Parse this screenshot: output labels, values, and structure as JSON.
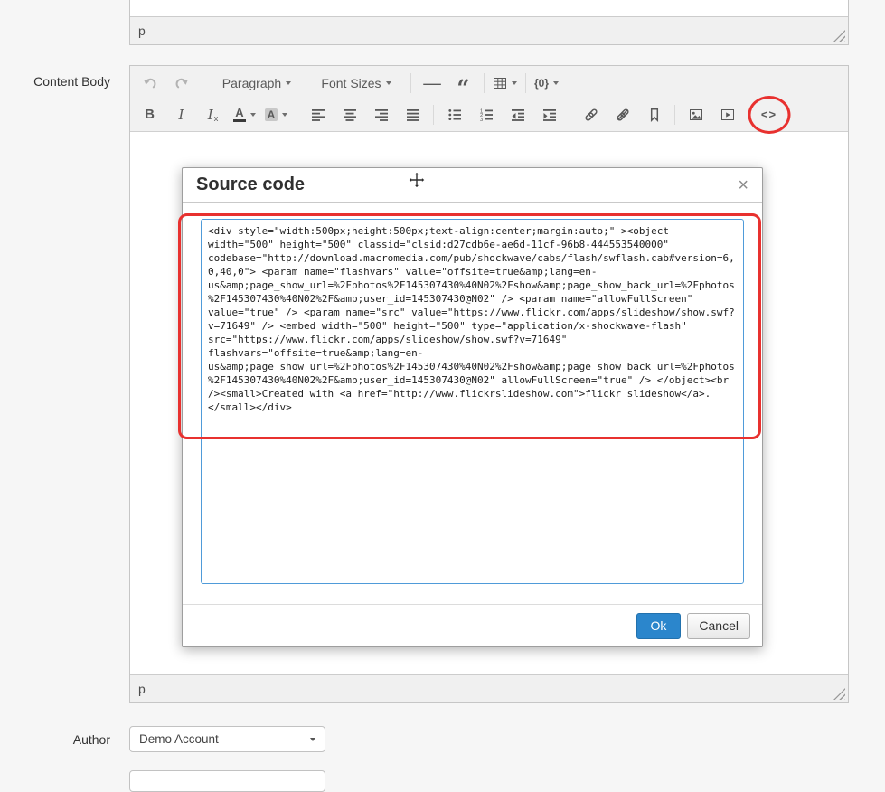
{
  "colors": {
    "primary_button": "#2b86cc",
    "annotation_red": "#e8312f",
    "focused_textarea_border": "#4f9bd9",
    "toolbar_background": "#f1f1f1"
  },
  "previous_editor": {
    "status_path": "p"
  },
  "editor": {
    "label": "Content Body",
    "status_path": "p",
    "toolbar": {
      "paragraph_label": "Paragraph",
      "font_sizes_label": "Font Sizes",
      "hr_glyph": "—",
      "blockquote_glyph": "“",
      "token_glyph": "{0}",
      "bold_glyph": "B",
      "italic_glyph": "I",
      "clearformat_glyph": "I",
      "clearformat_sub": "x",
      "forecolor_glyph": "A",
      "backcolor_glyph": "A",
      "code_glyph": "<>"
    }
  },
  "dialog": {
    "title": "Source code",
    "close_glyph": "×",
    "ok_label": "Ok",
    "cancel_label": "Cancel",
    "source_code": "<div style=\"width:500px;height:500px;text-align:center;margin:auto;\" ><object width=\"500\" height=\"500\" classid=\"clsid:d27cdb6e-ae6d-11cf-96b8-444553540000\" codebase=\"http://download.macromedia.com/pub/shockwave/cabs/flash/swflash.cab#version=6,0,40,0\"> <param name=\"flashvars\" value=\"offsite=true&amp;lang=en-us&amp;page_show_url=%2Fphotos%2F145307430%40N02%2Fshow&amp;page_show_back_url=%2Fphotos%2F145307430%40N02%2F&amp;user_id=145307430@N02\" /> <param name=\"allowFullScreen\" value=\"true\" /> <param name=\"src\" value=\"https://www.flickr.com/apps/slideshow/show.swf?v=71649\" /> <embed width=\"500\" height=\"500\" type=\"application/x-shockwave-flash\" src=\"https://www.flickr.com/apps/slideshow/show.swf?v=71649\" flashvars=\"offsite=true&amp;lang=en-us&amp;page_show_url=%2Fphotos%2F145307430%40N02%2Fshow&amp;page_show_back_url=%2Fphotos%2F145307430%40N02%2F&amp;user_id=145307430@N02\" allowFullScreen=\"true\" /> </object><br /><small>Created with <a href=\"http://www.flickrslideshow.com\">flickr slideshow</a>.</small></div>"
  },
  "author": {
    "label": "Author",
    "value": "Demo Account"
  }
}
